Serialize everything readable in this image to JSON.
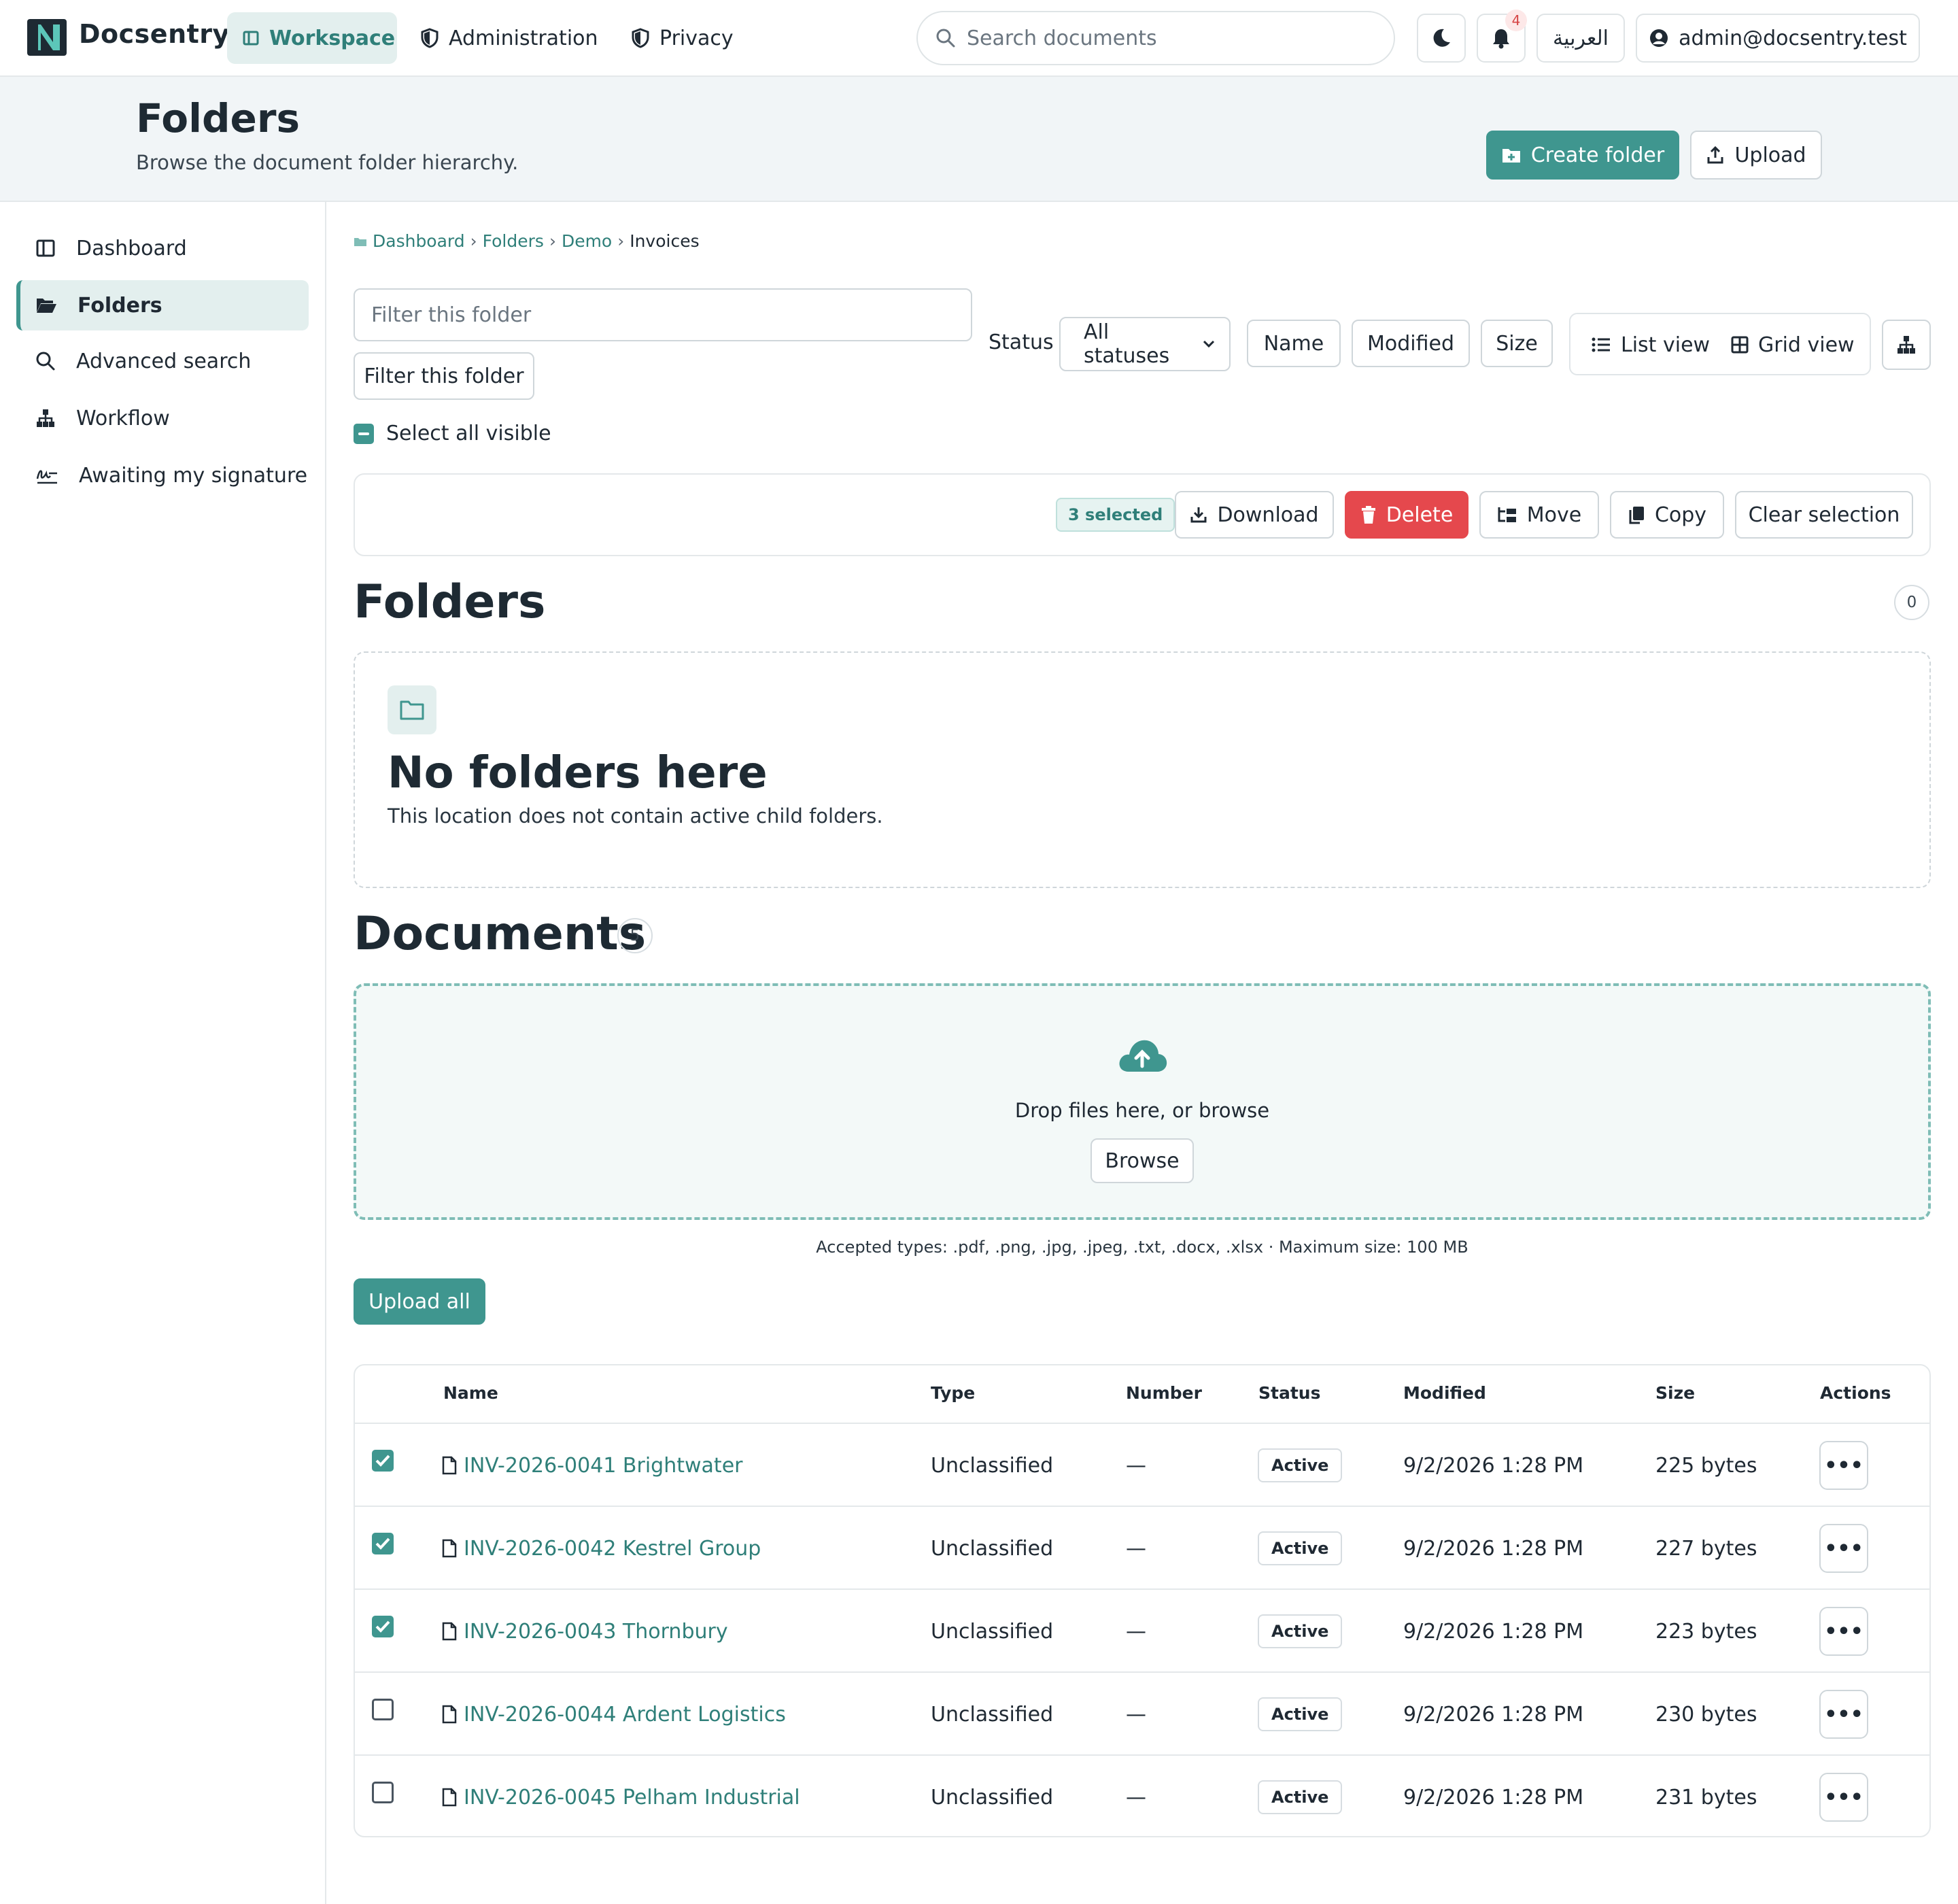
{
  "app": {
    "name": "Docsentry",
    "nav": [
      {
        "label": "Workspace",
        "icon": "workspace-icon",
        "active": true
      },
      {
        "label": "Administration",
        "icon": "shield-icon",
        "active": false
      },
      {
        "label": "Privacy",
        "icon": "shield-icon",
        "active": false
      }
    ],
    "search_placeholder": "Search documents",
    "notifications_count": "4",
    "language_label": "العربية",
    "user_email": "admin@docsentry.test"
  },
  "header": {
    "title": "Folders",
    "subtitle": "Browse the document folder hierarchy.",
    "create_folder_label": "Create folder",
    "upload_label": "Upload"
  },
  "sidebar": {
    "items": [
      {
        "label": "Dashboard",
        "icon": "dashboard-icon",
        "active": false
      },
      {
        "label": "Folders",
        "icon": "folder-open-icon",
        "active": true
      },
      {
        "label": "Advanced search",
        "icon": "search-icon",
        "active": false
      },
      {
        "label": "Workflow",
        "icon": "workflow-icon",
        "active": false
      },
      {
        "label": "Awaiting my signature",
        "icon": "signature-icon",
        "active": false
      }
    ]
  },
  "breadcrumb": [
    "Dashboard",
    "Folders",
    "Demo",
    "Invoices"
  ],
  "toolbar": {
    "filter_placeholder": "Filter this folder",
    "filter_button": "Filter this folder",
    "status_label": "Status",
    "status_value": "All statuses",
    "sort_name": "Name",
    "sort_modified": "Modified",
    "sort_size": "Size",
    "list_view": "List view",
    "grid_view": "Grid view"
  },
  "selection": {
    "select_all_label": "Select all visible",
    "selected_label": "3 selected",
    "download": "Download",
    "delete": "Delete",
    "move": "Move",
    "copy": "Copy",
    "clear": "Clear selection"
  },
  "folders_section": {
    "title": "Folders",
    "count": "0",
    "empty_title": "No folders here",
    "empty_text": "This location does not contain active child folders."
  },
  "documents_section": {
    "title": "Documents",
    "count": "5",
    "drop_text": "Drop files here, or browse",
    "browse_label": "Browse",
    "accepted_text": "Accepted types: .pdf, .png, .jpg, .jpeg, .txt, .docx, .xlsx · Maximum size: 100 MB",
    "upload_all_label": "Upload all"
  },
  "table": {
    "columns": [
      "Name",
      "Type",
      "Number",
      "Status",
      "Modified",
      "Size",
      "Actions"
    ],
    "rows": [
      {
        "checked": true,
        "name": "INV-2026-0041 Brightwater",
        "type": "Unclassified",
        "number": "—",
        "status": "Active",
        "modified": "9/2/2026 1:28 PM",
        "size": "225 bytes",
        "action": "•••"
      },
      {
        "checked": true,
        "name": "INV-2026-0042 Kestrel Group",
        "type": "Unclassified",
        "number": "—",
        "status": "Active",
        "modified": "9/2/2026 1:28 PM",
        "size": "227 bytes",
        "action": "•••"
      },
      {
        "checked": true,
        "name": "INV-2026-0043 Thornbury",
        "type": "Unclassified",
        "number": "—",
        "status": "Active",
        "modified": "9/2/2026 1:28 PM",
        "size": "223 bytes",
        "action": "•••"
      },
      {
        "checked": false,
        "name": "INV-2026-0044 Ardent Logistics",
        "type": "Unclassified",
        "number": "—",
        "status": "Active",
        "modified": "9/2/2026 1:28 PM",
        "size": "230 bytes",
        "action": "•••"
      },
      {
        "checked": false,
        "name": "INV-2026-0045 Pelham Industrial",
        "type": "Unclassified",
        "number": "—",
        "status": "Active",
        "modified": "9/2/2026 1:28 PM",
        "size": "231 bytes",
        "action": "•••"
      }
    ]
  },
  "colors": {
    "accent": "#3f968f",
    "accent_light": "#e3efee",
    "danger": "#e5484d",
    "link": "#2f7f79"
  }
}
